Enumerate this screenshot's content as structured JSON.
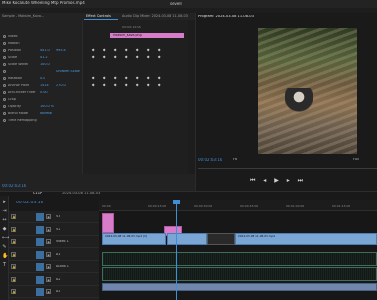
{
  "topbar": {
    "left_text": "Mike Kocalute Wheeling Mtp Promos.mp4",
    "center_text": "sevell"
  },
  "tabs": [
    {
      "label": "Sample - Maksim_Kova...",
      "active": false
    },
    {
      "label": "Effect Controls",
      "active": true
    },
    {
      "label": "Audio Clip Mixer: 2024-03-08 11-08-03",
      "active": false
    },
    {
      "label": "Program: 2024-03-08 11-08-03",
      "active": true
    }
  ],
  "effects": {
    "clip_label": "Maksim_Kova.png",
    "mini_tc": "00:00:15:00",
    "rows": [
      {
        "label": "Video",
        "value": "",
        "value2": ""
      },
      {
        "label": "Motion",
        "value": "",
        "value2": ""
      },
      {
        "label": "Position",
        "value": "441.0",
        "value2": "995.4"
      },
      {
        "label": "Scale",
        "value": "41.2",
        "value2": ""
      },
      {
        "label": "Scale Width",
        "value": "100.0",
        "value2": ""
      },
      {
        "label": "",
        "value": "",
        "value2": "Uniform Scale"
      },
      {
        "label": "Rotation",
        "value": "0.0",
        "value2": ""
      },
      {
        "label": "Anchor Point",
        "value": "1414",
        "value2": "270.0"
      },
      {
        "label": "Anti-flicker Filter",
        "value": "0.00",
        "value2": ""
      },
      {
        "label": "Crop",
        "value": "",
        "value2": ""
      },
      {
        "label": "Opacity",
        "value": "100.0 %",
        "value2": ""
      },
      {
        "label": "Blend Mode",
        "value": "Normal",
        "value2": ""
      },
      {
        "label": "Time Remapping",
        "value": "",
        "value2": ""
      }
    ]
  },
  "program": {
    "title": "Program: 2024-03-08 11-08-03",
    "timecode": "00:02:03:16",
    "fit": "Fit",
    "quality": "Full",
    "transport": "⏮ ◂ ▶ ▸ ⏭"
  },
  "timeline": {
    "tab1": "C11P",
    "tab2": "2024-03-08 11-08-03",
    "timecode": "00:02:03:16",
    "ruler_ticks": [
      "00:00",
      "00:00:15:00",
      "00:00:30:00",
      "00:00:45:00",
      "00:01:00:00",
      "00:01:15:00"
    ],
    "tracks": [
      {
        "name": "V3"
      },
      {
        "name": "V2"
      },
      {
        "name": "Video 1"
      },
      {
        "name": "A1"
      },
      {
        "name": "Audio 1"
      },
      {
        "name": "A2"
      },
      {
        "name": "A3"
      }
    ],
    "clips": {
      "v_clip_label": "2024-03-08 11-08-03.mp4 [V]",
      "v_clip_label2": "2024-03-08 11-08-03.mp4"
    }
  },
  "colors": {
    "accent": "#3f8fd6",
    "clip_pink": "#d77cc9",
    "clip_blue": "#7aa6d6",
    "audio_green": "#5b8f7a"
  }
}
